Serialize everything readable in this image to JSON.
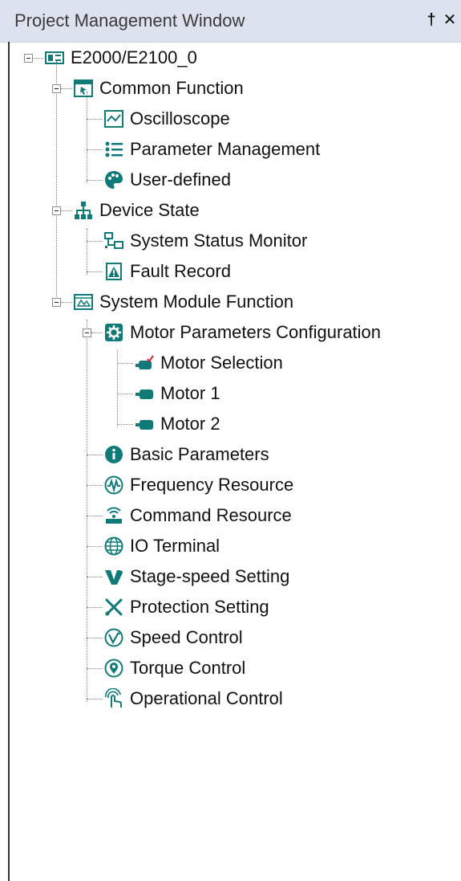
{
  "window": {
    "title": "Project Management Window"
  },
  "titlebar": {
    "pin_glyph": "†",
    "close_glyph": "✕"
  },
  "tree": {
    "root": "E2000/E2100_0",
    "common_function": {
      "label": "Common Function",
      "children": [
        "Oscilloscope",
        "Parameter Management",
        "User-defined"
      ]
    },
    "device_state": {
      "label": "Device State",
      "children": [
        "System Status Monitor",
        "Fault Record"
      ]
    },
    "system_module_function": {
      "label": "System Module Function",
      "motor_parameters": {
        "label": "Motor Parameters Configuration",
        "children": [
          "Motor Selection",
          "Motor 1",
          "Motor 2"
        ]
      },
      "children": [
        "Basic Parameters",
        "Frequency Resource",
        "Command Resource",
        "IO Terminal",
        "Stage-speed Setting",
        "Protection Setting",
        "Speed Control",
        "Torque Control",
        "Operational Control"
      ]
    }
  },
  "colors": {
    "accent": "#0f7a78",
    "titlebar": "#dde3ee"
  },
  "icons": [
    "device-icon",
    "function-icon",
    "oscilloscope-icon",
    "list-icon",
    "palette-icon",
    "hierarchy-icon",
    "status-monitor-icon",
    "fault-record-icon",
    "module-icon",
    "gear-icon",
    "motor-icon",
    "info-icon",
    "frequency-icon",
    "command-icon",
    "globe-icon",
    "v-icon",
    "tools-icon",
    "speed-icon",
    "location-pin-icon",
    "touch-icon"
  ]
}
